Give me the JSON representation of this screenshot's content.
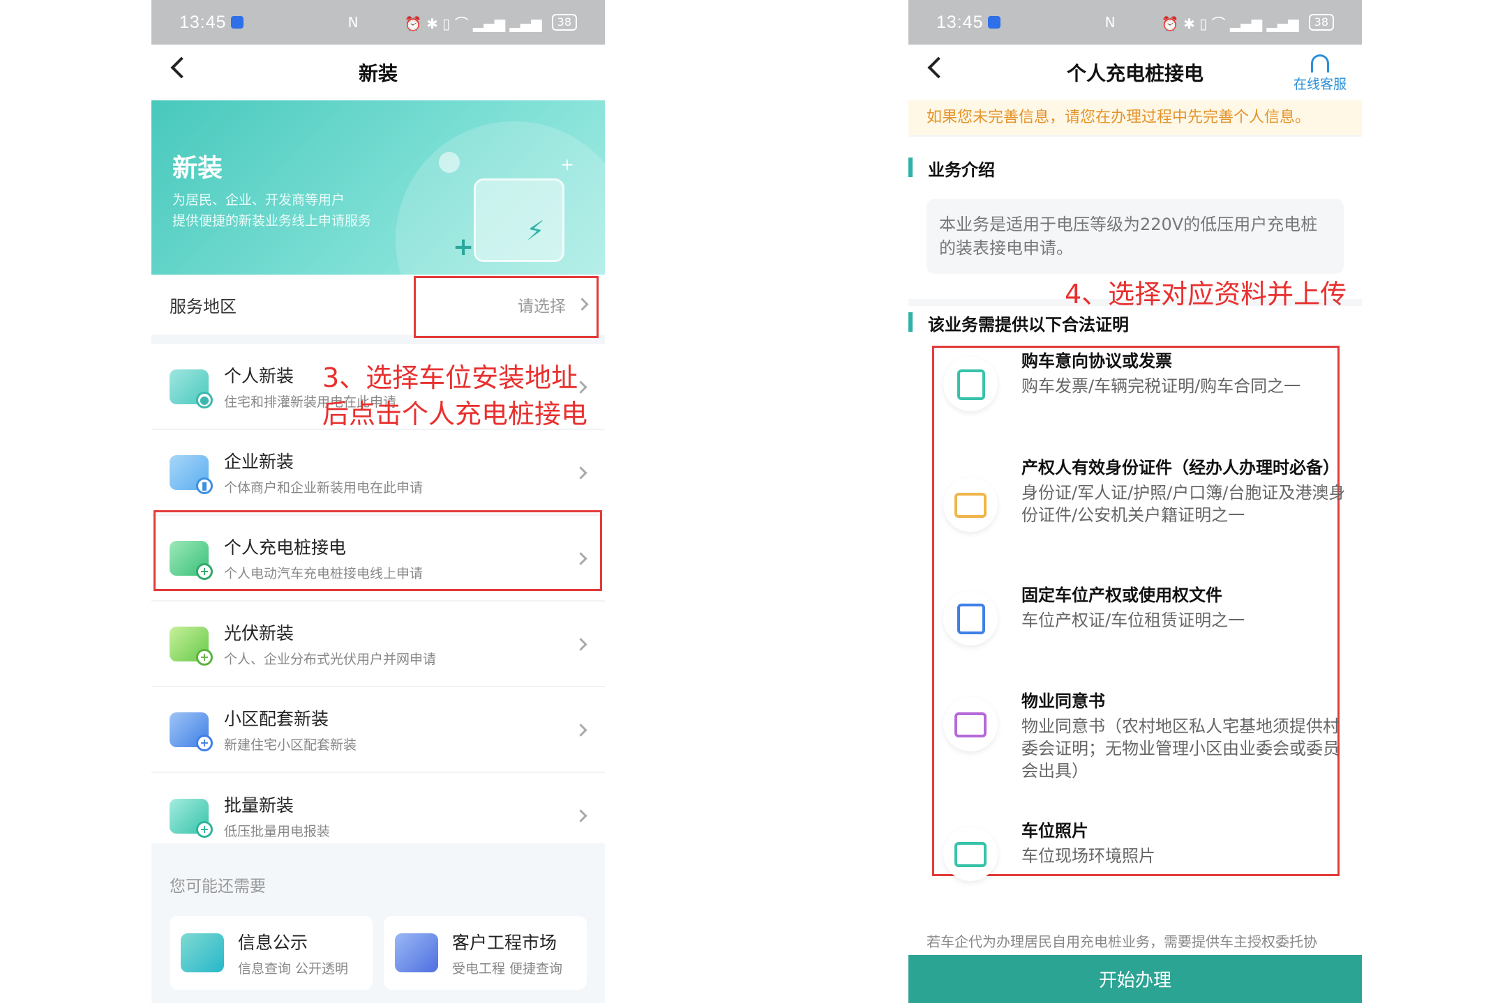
{
  "left": {
    "status": {
      "time": "13:45",
      "nfc": "N",
      "icons": "⏰ ✱ ▯ ⌒ ▂▄▆ ▂▄▆",
      "battery": "38"
    },
    "nav": {
      "title": "新装"
    },
    "banner": {
      "title": "新装",
      "line1": "为居民、企业、开发商等用户",
      "line2": "提供便捷的新装业务线上申请服务"
    },
    "region": {
      "label": "服务地区",
      "value": "请选择"
    },
    "services": [
      {
        "name": "个人新装",
        "desc": "住宅和排灌新装用电在此申请"
      },
      {
        "name": "企业新装",
        "desc": "个体商户和企业新装用电在此申请"
      },
      {
        "name": "个人充电桩接电",
        "desc": "个人电动汽车充电桩接电线上申请"
      },
      {
        "name": "光伏新装",
        "desc": "个人、企业分布式光伏用户并网申请"
      },
      {
        "name": "小区配套新装",
        "desc": "新建住宅小区配套新装"
      },
      {
        "name": "批量新装",
        "desc": "低压批量用电报装"
      }
    ],
    "more": {
      "title": "您可能还需要",
      "cards": [
        {
          "name": "信息公示",
          "desc": "信息查询 公开透明"
        },
        {
          "name": "客户工程市场",
          "desc": "受电工程 便捷查询"
        }
      ]
    },
    "annotation": {
      "line1": "3、选择车位安装地址",
      "line2": "后点击个人充电桩接电"
    }
  },
  "right": {
    "status": {
      "time": "13:45",
      "nfc": "N",
      "icons": "⏰ ✱ ▯ ⌒ ▂▄▆ ▂▄▆",
      "battery": "38"
    },
    "nav": {
      "title": "个人充电桩接电",
      "service": "在线客服"
    },
    "notice": "如果您未完善信息，请您在办理过程中先完善个人信息。",
    "intro_title": "业务介绍",
    "intro_text": "本业务是适用于电压等级为220V的低压用户充电桩的装表接电申请。",
    "docs_title": "该业务需提供以下合法证明",
    "annotation": "4、选择对应资料并上传",
    "docs": [
      {
        "name": "购车意向协议或发票",
        "desc": "购车发票/车辆完税证明/购车合同之一"
      },
      {
        "name": "产权人有效身份证件（经办人办理时必备）",
        "desc": "身份证/军人证/护照/户口簿/台胞证及港澳身份证件/公安机关户籍证明之一"
      },
      {
        "name": "固定车位产权或使用权文件",
        "desc": "车位产权证/车位租赁证明之一"
      },
      {
        "name": "物业同意书",
        "desc": "物业同意书（农村地区私人宅基地须提供村委会证明；无物业管理小区由业委会或委员会出具）"
      },
      {
        "name": "车位照片",
        "desc": "车位现场环境照片"
      }
    ],
    "footnote": "若车企代为办理居民自用充电桩业务，需要提供车主授权委托协",
    "start": "开始办理"
  },
  "colors": {
    "accent": "#2ca494",
    "annotation": "#e8302f",
    "notice": "#e4932a"
  },
  "icons": {
    "back": "chevron-left-icon",
    "service": "headset-icon",
    "row": "chevron-right-icon"
  }
}
